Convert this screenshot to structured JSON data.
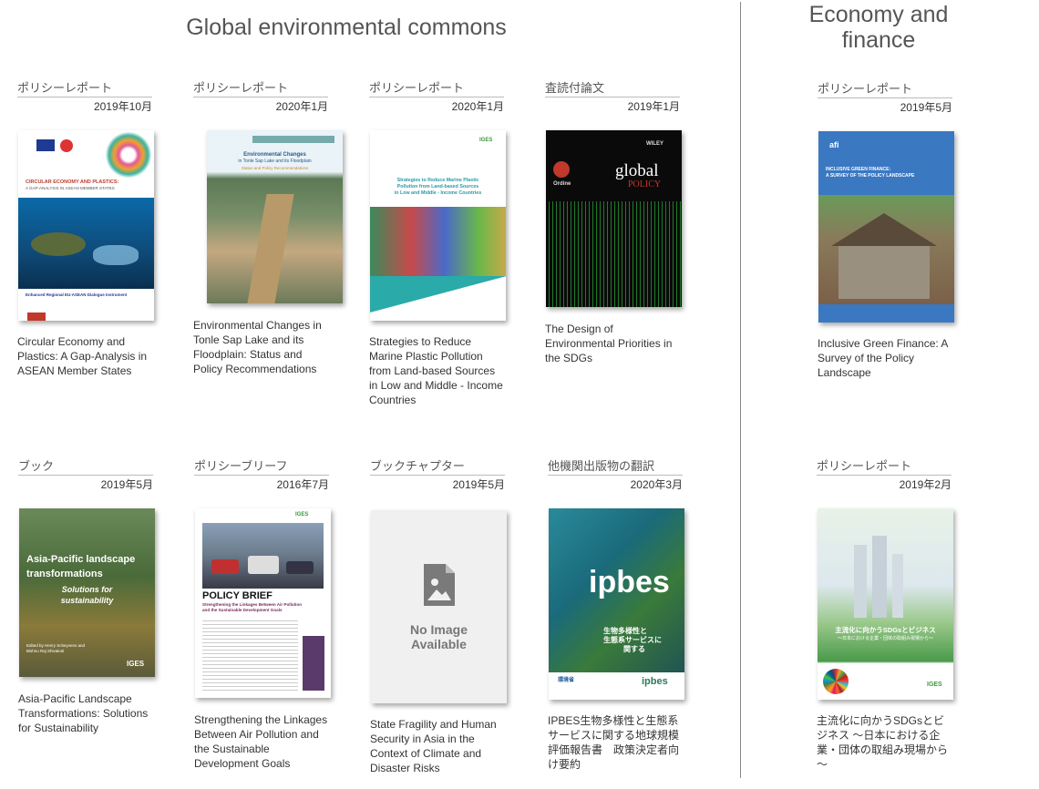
{
  "sections": {
    "global": {
      "title": "Global environmental commons"
    },
    "economy": {
      "title": "Economy and finance"
    }
  },
  "publications": [
    {
      "category": "ポリシーレポート",
      "date": "2019年10月",
      "title": "Circular Economy and Plastics: A Gap-Analysis in ASEAN Member States",
      "cover_texts": [
        "CIRCULAR ECONOMY AND PLASTICS:",
        "A GAP-ANALYSIS IN ASEAN MEMBER STATES",
        "Enhanced Regional EU-ASEAN Dialogue Instrument"
      ]
    },
    {
      "category": "ポリシーレポート",
      "date": "2020年1月",
      "title": "Environmental Changes in Tonle Sap Lake and its Floodplain: Status and Policy Recommendations",
      "cover_texts": [
        "Environmental Changes",
        "in Tonle Sap Lake and its Floodplain",
        "Status and Policy Recommendations"
      ]
    },
    {
      "category": "ポリシーレポート",
      "date": "2020年1月",
      "title": "Strategies to Reduce Marine Plastic Pollution from Land-based Sources in Low and Middle - Income Countries",
      "cover_texts": [
        "Strategies to Reduce Marine Plastic",
        "Pollution from Land-based Sources",
        "in Low and Middle - Income Countries",
        "IGES"
      ]
    },
    {
      "category": "査読付論文",
      "date": "2019年1月",
      "title": "The Design of Environmental Priorities in the SDGs",
      "cover_texts": [
        "global",
        "POLICY",
        "Ordine",
        "WILEY"
      ]
    },
    {
      "category": "ポリシーレポート",
      "date": "2019年5月",
      "title": "Inclusive Green Finance: A Survey of the Policy Landscape",
      "cover_texts": [
        "afi",
        "INCLUSIVE GREEN FINANCE:",
        "A SURVEY OF THE POLICY LANDSCAPE"
      ]
    },
    {
      "category": "ブック",
      "date": "2019年5月",
      "title": "Asia-Pacific Landscape Transformations: Solutions for Sustainability",
      "cover_texts": [
        "Asia-Pacific landscape",
        "transformations",
        "Solutions for",
        "sustainability",
        "Edited by Henry Scheyvens and",
        "Bishnu Raj Shivakoti",
        "IGES"
      ]
    },
    {
      "category": "ポリシーブリーフ",
      "date": "2016年7月",
      "title": "Strengthening the Linkages Between Air Pollution and the Sustainable Development Goals",
      "cover_texts": [
        "POLICY BRIEF",
        "Strengthening the Linkages Between Air Pollution",
        "and the Sustainable Development Goals",
        "IGES"
      ]
    },
    {
      "category": "ブックチャプター",
      "date": "2019年5月",
      "title": "State Fragility and Human Security in Asia in the Context of Climate and Disaster Risks",
      "cover_texts": [
        "No Image",
        "Available"
      ]
    },
    {
      "category": "他機関出版物の翻訳",
      "date": "2020年3月",
      "title": "IPBES生物多様性と生態系サービスに関する地球規模評価報告書　政策決定者向け要約",
      "cover_texts": [
        "ipbes",
        "生物多様性と",
        "生態系サービスに",
        "関する",
        "環境省",
        "ipbes"
      ]
    },
    {
      "category": "ポリシーレポート",
      "date": "2019年2月",
      "title": "主流化に向かうSDGsとビジネス ～日本における企業・団体の取組み現場から～",
      "cover_texts": [
        "主流化に向かうSDGsとビジネス",
        "～日本における企業・団体の取組み現場から～",
        "IGES"
      ]
    }
  ],
  "colors": {
    "divider": "#888888",
    "rule": "#bbbbbb",
    "title_text": "#555555"
  }
}
